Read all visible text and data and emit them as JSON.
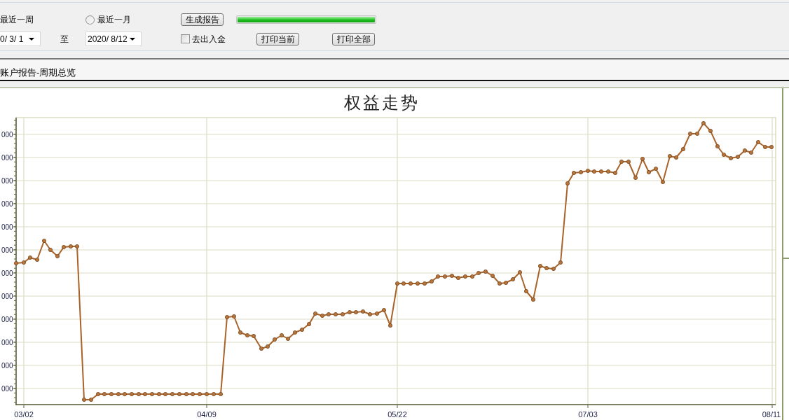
{
  "toolbar": {
    "period_label": "最近一周",
    "radio": {
      "label": "最近一月",
      "selected": false
    },
    "generate_button": "生成报告",
    "progress": {
      "level": 1
    },
    "start_date": "0/ 3/ 1",
    "to_label": "至",
    "end_date": "2020/ 8/12",
    "checkbox": {
      "label": "去出入金",
      "checked": false
    },
    "buttons": [
      "打印当前",
      "打印全部"
    ]
  },
  "tab": {
    "title": "账户报告-周期总览"
  },
  "chart": {
    "title": "权益走势",
    "y_tick_labels": [
      "000",
      "000",
      "000",
      "000",
      "000",
      "000",
      "000",
      "000",
      "000",
      "000",
      "000",
      "000"
    ],
    "x_tick_labels": [
      "03/02",
      "04/09",
      "05/22",
      "07/03",
      "08/11"
    ]
  }
}
